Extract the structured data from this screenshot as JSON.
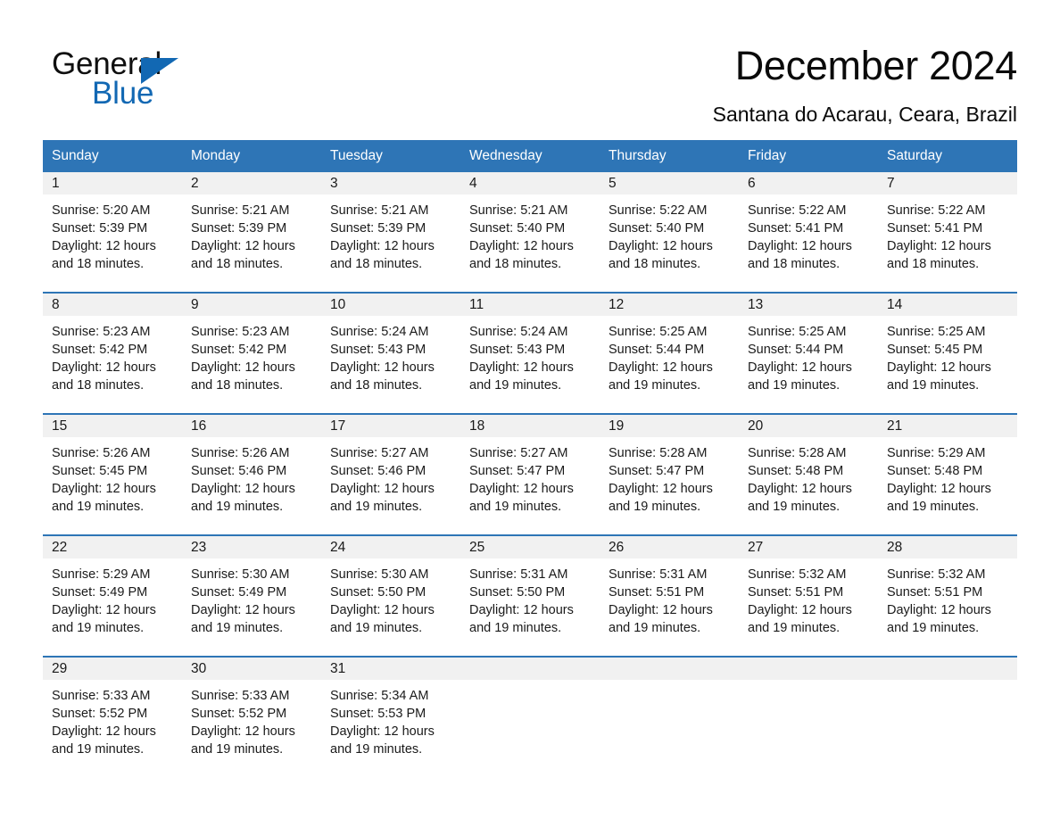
{
  "brand": {
    "name_part1": "General",
    "name_part2": "Blue",
    "accent_color": "#1268b3",
    "triangle_icon": "triangle-icon"
  },
  "header": {
    "title": "December 2024",
    "subtitle": "Santana do Acarau, Ceara, Brazil"
  },
  "theme": {
    "header_blue": "#2e75b6",
    "daynum_band": "#f1f1f1",
    "text": "#1a1a1a"
  },
  "weekdays": [
    "Sunday",
    "Monday",
    "Tuesday",
    "Wednesday",
    "Thursday",
    "Friday",
    "Saturday"
  ],
  "labels": {
    "sunrise_prefix": "Sunrise:",
    "sunset_prefix": "Sunset:",
    "daylight_prefix": "Daylight:"
  },
  "weeks": [
    [
      {
        "day": "1",
        "sunrise": "Sunrise: 5:20 AM",
        "sunset": "Sunset: 5:39 PM",
        "daylight_l1": "Daylight: 12 hours",
        "daylight_l2": "and 18 minutes."
      },
      {
        "day": "2",
        "sunrise": "Sunrise: 5:21 AM",
        "sunset": "Sunset: 5:39 PM",
        "daylight_l1": "Daylight: 12 hours",
        "daylight_l2": "and 18 minutes."
      },
      {
        "day": "3",
        "sunrise": "Sunrise: 5:21 AM",
        "sunset": "Sunset: 5:39 PM",
        "daylight_l1": "Daylight: 12 hours",
        "daylight_l2": "and 18 minutes."
      },
      {
        "day": "4",
        "sunrise": "Sunrise: 5:21 AM",
        "sunset": "Sunset: 5:40 PM",
        "daylight_l1": "Daylight: 12 hours",
        "daylight_l2": "and 18 minutes."
      },
      {
        "day": "5",
        "sunrise": "Sunrise: 5:22 AM",
        "sunset": "Sunset: 5:40 PM",
        "daylight_l1": "Daylight: 12 hours",
        "daylight_l2": "and 18 minutes."
      },
      {
        "day": "6",
        "sunrise": "Sunrise: 5:22 AM",
        "sunset": "Sunset: 5:41 PM",
        "daylight_l1": "Daylight: 12 hours",
        "daylight_l2": "and 18 minutes."
      },
      {
        "day": "7",
        "sunrise": "Sunrise: 5:22 AM",
        "sunset": "Sunset: 5:41 PM",
        "daylight_l1": "Daylight: 12 hours",
        "daylight_l2": "and 18 minutes."
      }
    ],
    [
      {
        "day": "8",
        "sunrise": "Sunrise: 5:23 AM",
        "sunset": "Sunset: 5:42 PM",
        "daylight_l1": "Daylight: 12 hours",
        "daylight_l2": "and 18 minutes."
      },
      {
        "day": "9",
        "sunrise": "Sunrise: 5:23 AM",
        "sunset": "Sunset: 5:42 PM",
        "daylight_l1": "Daylight: 12 hours",
        "daylight_l2": "and 18 minutes."
      },
      {
        "day": "10",
        "sunrise": "Sunrise: 5:24 AM",
        "sunset": "Sunset: 5:43 PM",
        "daylight_l1": "Daylight: 12 hours",
        "daylight_l2": "and 18 minutes."
      },
      {
        "day": "11",
        "sunrise": "Sunrise: 5:24 AM",
        "sunset": "Sunset: 5:43 PM",
        "daylight_l1": "Daylight: 12 hours",
        "daylight_l2": "and 19 minutes."
      },
      {
        "day": "12",
        "sunrise": "Sunrise: 5:25 AM",
        "sunset": "Sunset: 5:44 PM",
        "daylight_l1": "Daylight: 12 hours",
        "daylight_l2": "and 19 minutes."
      },
      {
        "day": "13",
        "sunrise": "Sunrise: 5:25 AM",
        "sunset": "Sunset: 5:44 PM",
        "daylight_l1": "Daylight: 12 hours",
        "daylight_l2": "and 19 minutes."
      },
      {
        "day": "14",
        "sunrise": "Sunrise: 5:25 AM",
        "sunset": "Sunset: 5:45 PM",
        "daylight_l1": "Daylight: 12 hours",
        "daylight_l2": "and 19 minutes."
      }
    ],
    [
      {
        "day": "15",
        "sunrise": "Sunrise: 5:26 AM",
        "sunset": "Sunset: 5:45 PM",
        "daylight_l1": "Daylight: 12 hours",
        "daylight_l2": "and 19 minutes."
      },
      {
        "day": "16",
        "sunrise": "Sunrise: 5:26 AM",
        "sunset": "Sunset: 5:46 PM",
        "daylight_l1": "Daylight: 12 hours",
        "daylight_l2": "and 19 minutes."
      },
      {
        "day": "17",
        "sunrise": "Sunrise: 5:27 AM",
        "sunset": "Sunset: 5:46 PM",
        "daylight_l1": "Daylight: 12 hours",
        "daylight_l2": "and 19 minutes."
      },
      {
        "day": "18",
        "sunrise": "Sunrise: 5:27 AM",
        "sunset": "Sunset: 5:47 PM",
        "daylight_l1": "Daylight: 12 hours",
        "daylight_l2": "and 19 minutes."
      },
      {
        "day": "19",
        "sunrise": "Sunrise: 5:28 AM",
        "sunset": "Sunset: 5:47 PM",
        "daylight_l1": "Daylight: 12 hours",
        "daylight_l2": "and 19 minutes."
      },
      {
        "day": "20",
        "sunrise": "Sunrise: 5:28 AM",
        "sunset": "Sunset: 5:48 PM",
        "daylight_l1": "Daylight: 12 hours",
        "daylight_l2": "and 19 minutes."
      },
      {
        "day": "21",
        "sunrise": "Sunrise: 5:29 AM",
        "sunset": "Sunset: 5:48 PM",
        "daylight_l1": "Daylight: 12 hours",
        "daylight_l2": "and 19 minutes."
      }
    ],
    [
      {
        "day": "22",
        "sunrise": "Sunrise: 5:29 AM",
        "sunset": "Sunset: 5:49 PM",
        "daylight_l1": "Daylight: 12 hours",
        "daylight_l2": "and 19 minutes."
      },
      {
        "day": "23",
        "sunrise": "Sunrise: 5:30 AM",
        "sunset": "Sunset: 5:49 PM",
        "daylight_l1": "Daylight: 12 hours",
        "daylight_l2": "and 19 minutes."
      },
      {
        "day": "24",
        "sunrise": "Sunrise: 5:30 AM",
        "sunset": "Sunset: 5:50 PM",
        "daylight_l1": "Daylight: 12 hours",
        "daylight_l2": "and 19 minutes."
      },
      {
        "day": "25",
        "sunrise": "Sunrise: 5:31 AM",
        "sunset": "Sunset: 5:50 PM",
        "daylight_l1": "Daylight: 12 hours",
        "daylight_l2": "and 19 minutes."
      },
      {
        "day": "26",
        "sunrise": "Sunrise: 5:31 AM",
        "sunset": "Sunset: 5:51 PM",
        "daylight_l1": "Daylight: 12 hours",
        "daylight_l2": "and 19 minutes."
      },
      {
        "day": "27",
        "sunrise": "Sunrise: 5:32 AM",
        "sunset": "Sunset: 5:51 PM",
        "daylight_l1": "Daylight: 12 hours",
        "daylight_l2": "and 19 minutes."
      },
      {
        "day": "28",
        "sunrise": "Sunrise: 5:32 AM",
        "sunset": "Sunset: 5:51 PM",
        "daylight_l1": "Daylight: 12 hours",
        "daylight_l2": "and 19 minutes."
      }
    ],
    [
      {
        "day": "29",
        "sunrise": "Sunrise: 5:33 AM",
        "sunset": "Sunset: 5:52 PM",
        "daylight_l1": "Daylight: 12 hours",
        "daylight_l2": "and 19 minutes."
      },
      {
        "day": "30",
        "sunrise": "Sunrise: 5:33 AM",
        "sunset": "Sunset: 5:52 PM",
        "daylight_l1": "Daylight: 12 hours",
        "daylight_l2": "and 19 minutes."
      },
      {
        "day": "31",
        "sunrise": "Sunrise: 5:34 AM",
        "sunset": "Sunset: 5:53 PM",
        "daylight_l1": "Daylight: 12 hours",
        "daylight_l2": "and 19 minutes."
      },
      {
        "day": "",
        "sunrise": "",
        "sunset": "",
        "daylight_l1": "",
        "daylight_l2": ""
      },
      {
        "day": "",
        "sunrise": "",
        "sunset": "",
        "daylight_l1": "",
        "daylight_l2": ""
      },
      {
        "day": "",
        "sunrise": "",
        "sunset": "",
        "daylight_l1": "",
        "daylight_l2": ""
      },
      {
        "day": "",
        "sunrise": "",
        "sunset": "",
        "daylight_l1": "",
        "daylight_l2": ""
      }
    ]
  ]
}
